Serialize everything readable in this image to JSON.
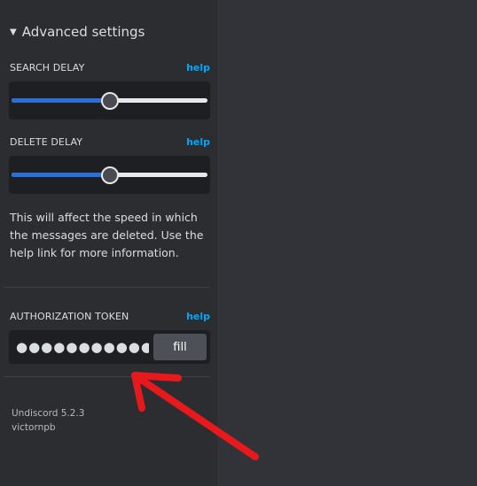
{
  "section": {
    "title": "Advanced settings",
    "caret": "▼"
  },
  "search_delay": {
    "label": "SEARCH DELAY",
    "help": "help",
    "value_fraction": 0.5
  },
  "delete_delay": {
    "label": "DELETE DELAY",
    "help": "help",
    "value_fraction": 0.5
  },
  "info_text": "This will affect the speed in which the messages are deleted. Use the help link for more information.",
  "authorization": {
    "label": "AUTHORIZATION TOKEN",
    "help": "help",
    "masked_value": "●●●●●●●●●●●●●●●●●●●●●●",
    "fill_label": "fill"
  },
  "footer": {
    "version": "Undiscord 5.2.3",
    "author": "victornpb"
  },
  "colors": {
    "sidebar_bg": "#2b2d31",
    "main_bg": "#313338",
    "link": "#00a8fc",
    "slider_fill": "#2b6ed8",
    "arrow": "#e8191c"
  },
  "annotation_icon": "red-arrow-icon"
}
